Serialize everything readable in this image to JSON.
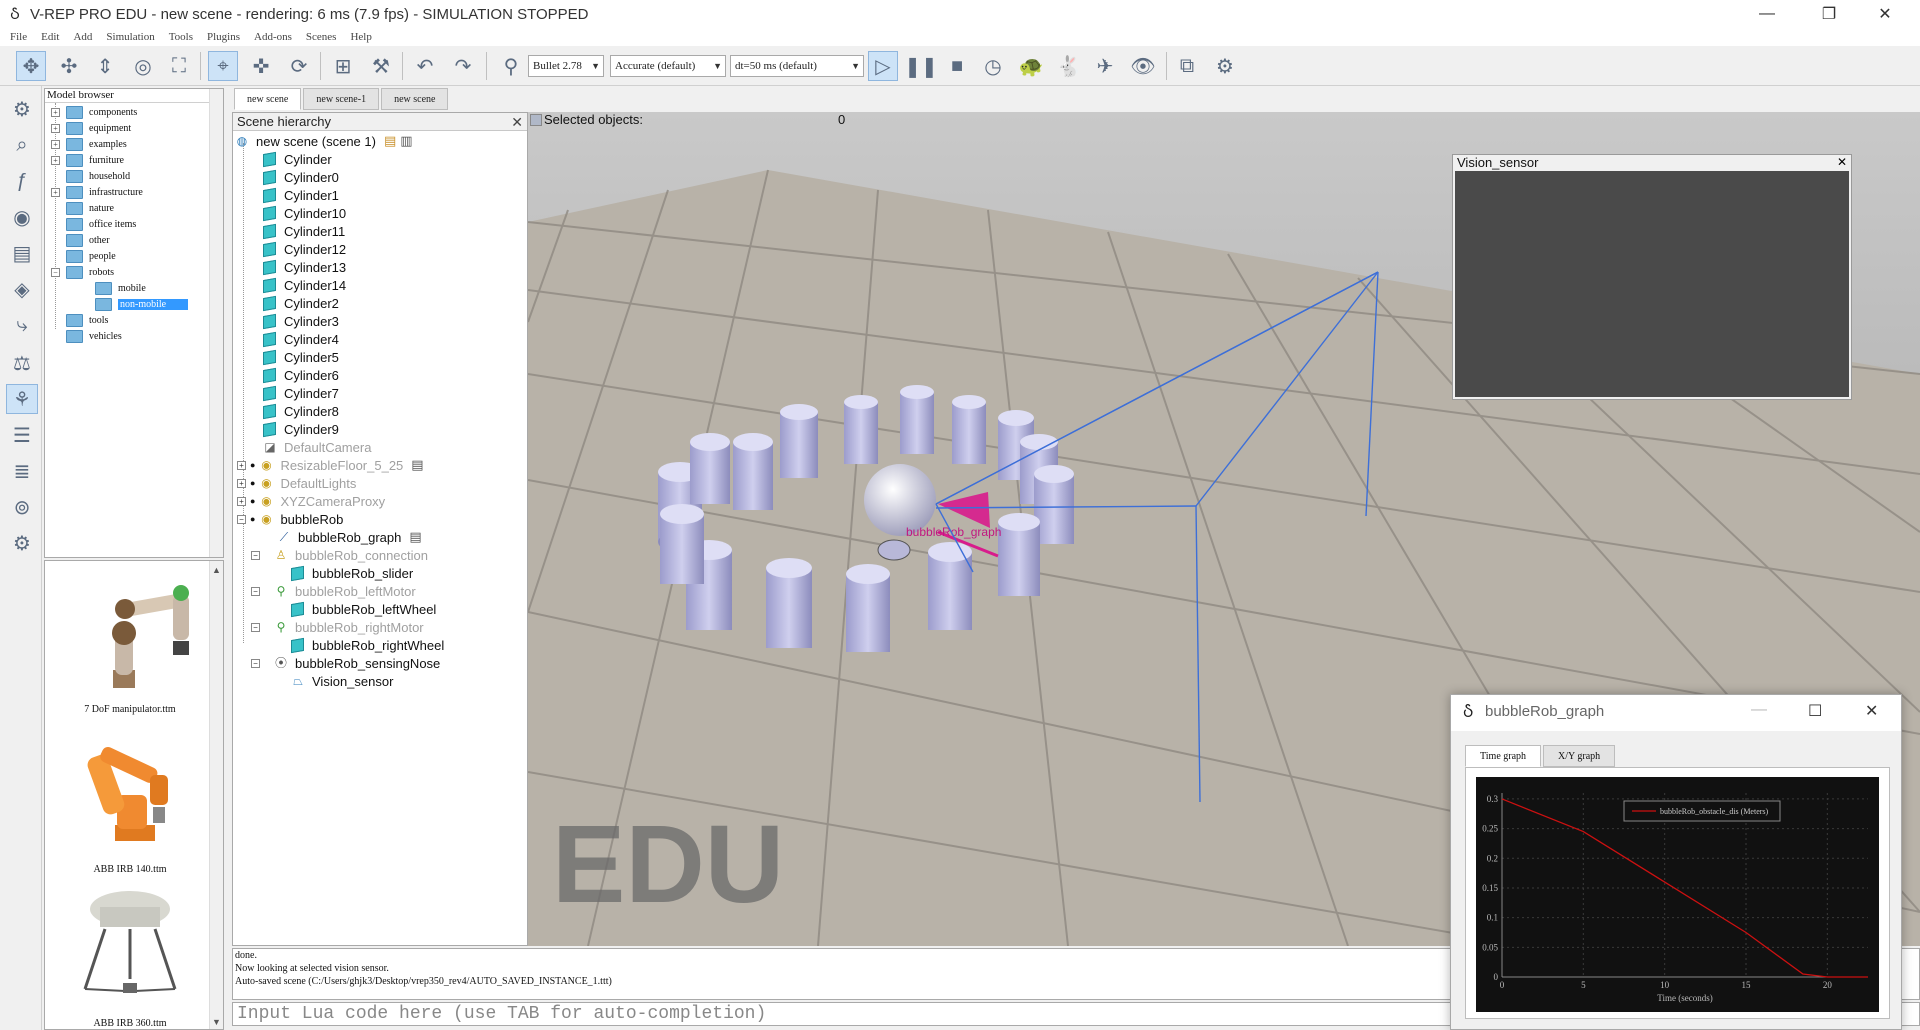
{
  "window": {
    "title": "V-REP PRO EDU - new scene - rendering: 6 ms (7.9 fps) - SIMULATION STOPPED",
    "minimize_glyph": "—",
    "maximize_glyph": "❐",
    "close_glyph": "✕"
  },
  "menu": [
    "File",
    "Edit",
    "Add",
    "Simulation",
    "Tools",
    "Plugins",
    "Add-ons",
    "Scenes",
    "Help"
  ],
  "toolbar": {
    "engine": "Bullet 2.78",
    "accuracy": "Accurate (default)",
    "timestep": "dt=50 ms (default)"
  },
  "model_browser": {
    "title": "Model browser",
    "items": [
      {
        "label": "components",
        "expander": "+"
      },
      {
        "label": "equipment",
        "expander": "+"
      },
      {
        "label": "examples",
        "expander": "+"
      },
      {
        "label": "furniture",
        "expander": "+"
      },
      {
        "label": "household",
        "expander": ""
      },
      {
        "label": "infrastructure",
        "expander": "+"
      },
      {
        "label": "nature",
        "expander": ""
      },
      {
        "label": "office items",
        "expander": ""
      },
      {
        "label": "other",
        "expander": ""
      },
      {
        "label": "people",
        "expander": ""
      },
      {
        "label": "robots",
        "expander": "−"
      },
      {
        "label": "mobile",
        "expander": ""
      },
      {
        "label": "non-mobile",
        "expander": ""
      },
      {
        "label": "tools",
        "expander": ""
      },
      {
        "label": "vehicles",
        "expander": ""
      }
    ],
    "thumbnails": [
      "7 DoF manipulator.ttm",
      "ABB IRB 140.ttm",
      "ABB IRB 360.ttm"
    ]
  },
  "scene_tabs": [
    "new scene",
    "new scene-1",
    "new scene"
  ],
  "hierarchy": {
    "title": "Scene hierarchy",
    "close_glyph": "✕",
    "root": "new scene (scene 1)",
    "items": [
      "Cylinder",
      "Cylinder0",
      "Cylinder1",
      "Cylinder10",
      "Cylinder11",
      "Cylinder12",
      "Cylinder13",
      "Cylinder14",
      "Cylinder2",
      "Cylinder3",
      "Cylinder4",
      "Cylinder5",
      "Cylinder6",
      "Cylinder7",
      "Cylinder8",
      "Cylinder9"
    ],
    "others": [
      "DefaultCamera",
      "ResizableFloor_5_25",
      "DefaultLights",
      "XYZCameraProxy",
      "bubbleRob",
      "bubbleRob_graph",
      "bubbleRob_connection",
      "bubbleRob_slider",
      "bubbleRob_leftMotor",
      "bubbleRob_leftWheel",
      "bubbleRob_rightMotor",
      "bubbleRob_rightWheel",
      "bubbleRob_sensingNose",
      "Vision_sensor"
    ]
  },
  "view": {
    "selected_label": "Selected objects:",
    "selected_count": "0",
    "watermark": "EDU",
    "robot_label": "bubbleRob_graph"
  },
  "vision_sensor": {
    "title": "Vision_sensor",
    "close_glyph": "✕"
  },
  "info": {
    "lines": [
      "done.",
      "Now looking at selected vision sensor.",
      "Auto-saved scene (C:/Users/ghjk3/Desktop/vrep350_rev4/AUTO_SAVED_INSTANCE_1.ttt)"
    ],
    "lua_placeholder": "Input Lua code here (use TAB for auto-completion)"
  },
  "graph_window": {
    "title": "bubbleRob_graph",
    "tabs": [
      "Time graph",
      "X/Y graph"
    ]
  },
  "chart_data": {
    "type": "line",
    "xlabel": "Time (seconds)",
    "ylabel": "",
    "xlim": [
      0,
      22.5
    ],
    "ylim": [
      0,
      0.31
    ],
    "x_ticks": [
      "0",
      "5",
      "10",
      "15",
      "20"
    ],
    "y_ticks": [
      "0",
      "0.05",
      "0.1",
      "0.15",
      "0.2",
      "0.25",
      "0.3"
    ],
    "series": [
      {
        "name": "bubbleRob_obstacle_dis (Meters)",
        "color": "#cc1010",
        "x": [
          0,
          5,
          10,
          15,
          18.5,
          20,
          22.5
        ],
        "y": [
          0.3,
          0.245,
          0.16,
          0.075,
          0.005,
          0,
          0
        ]
      }
    ],
    "legend": "top-right",
    "grid": true
  }
}
